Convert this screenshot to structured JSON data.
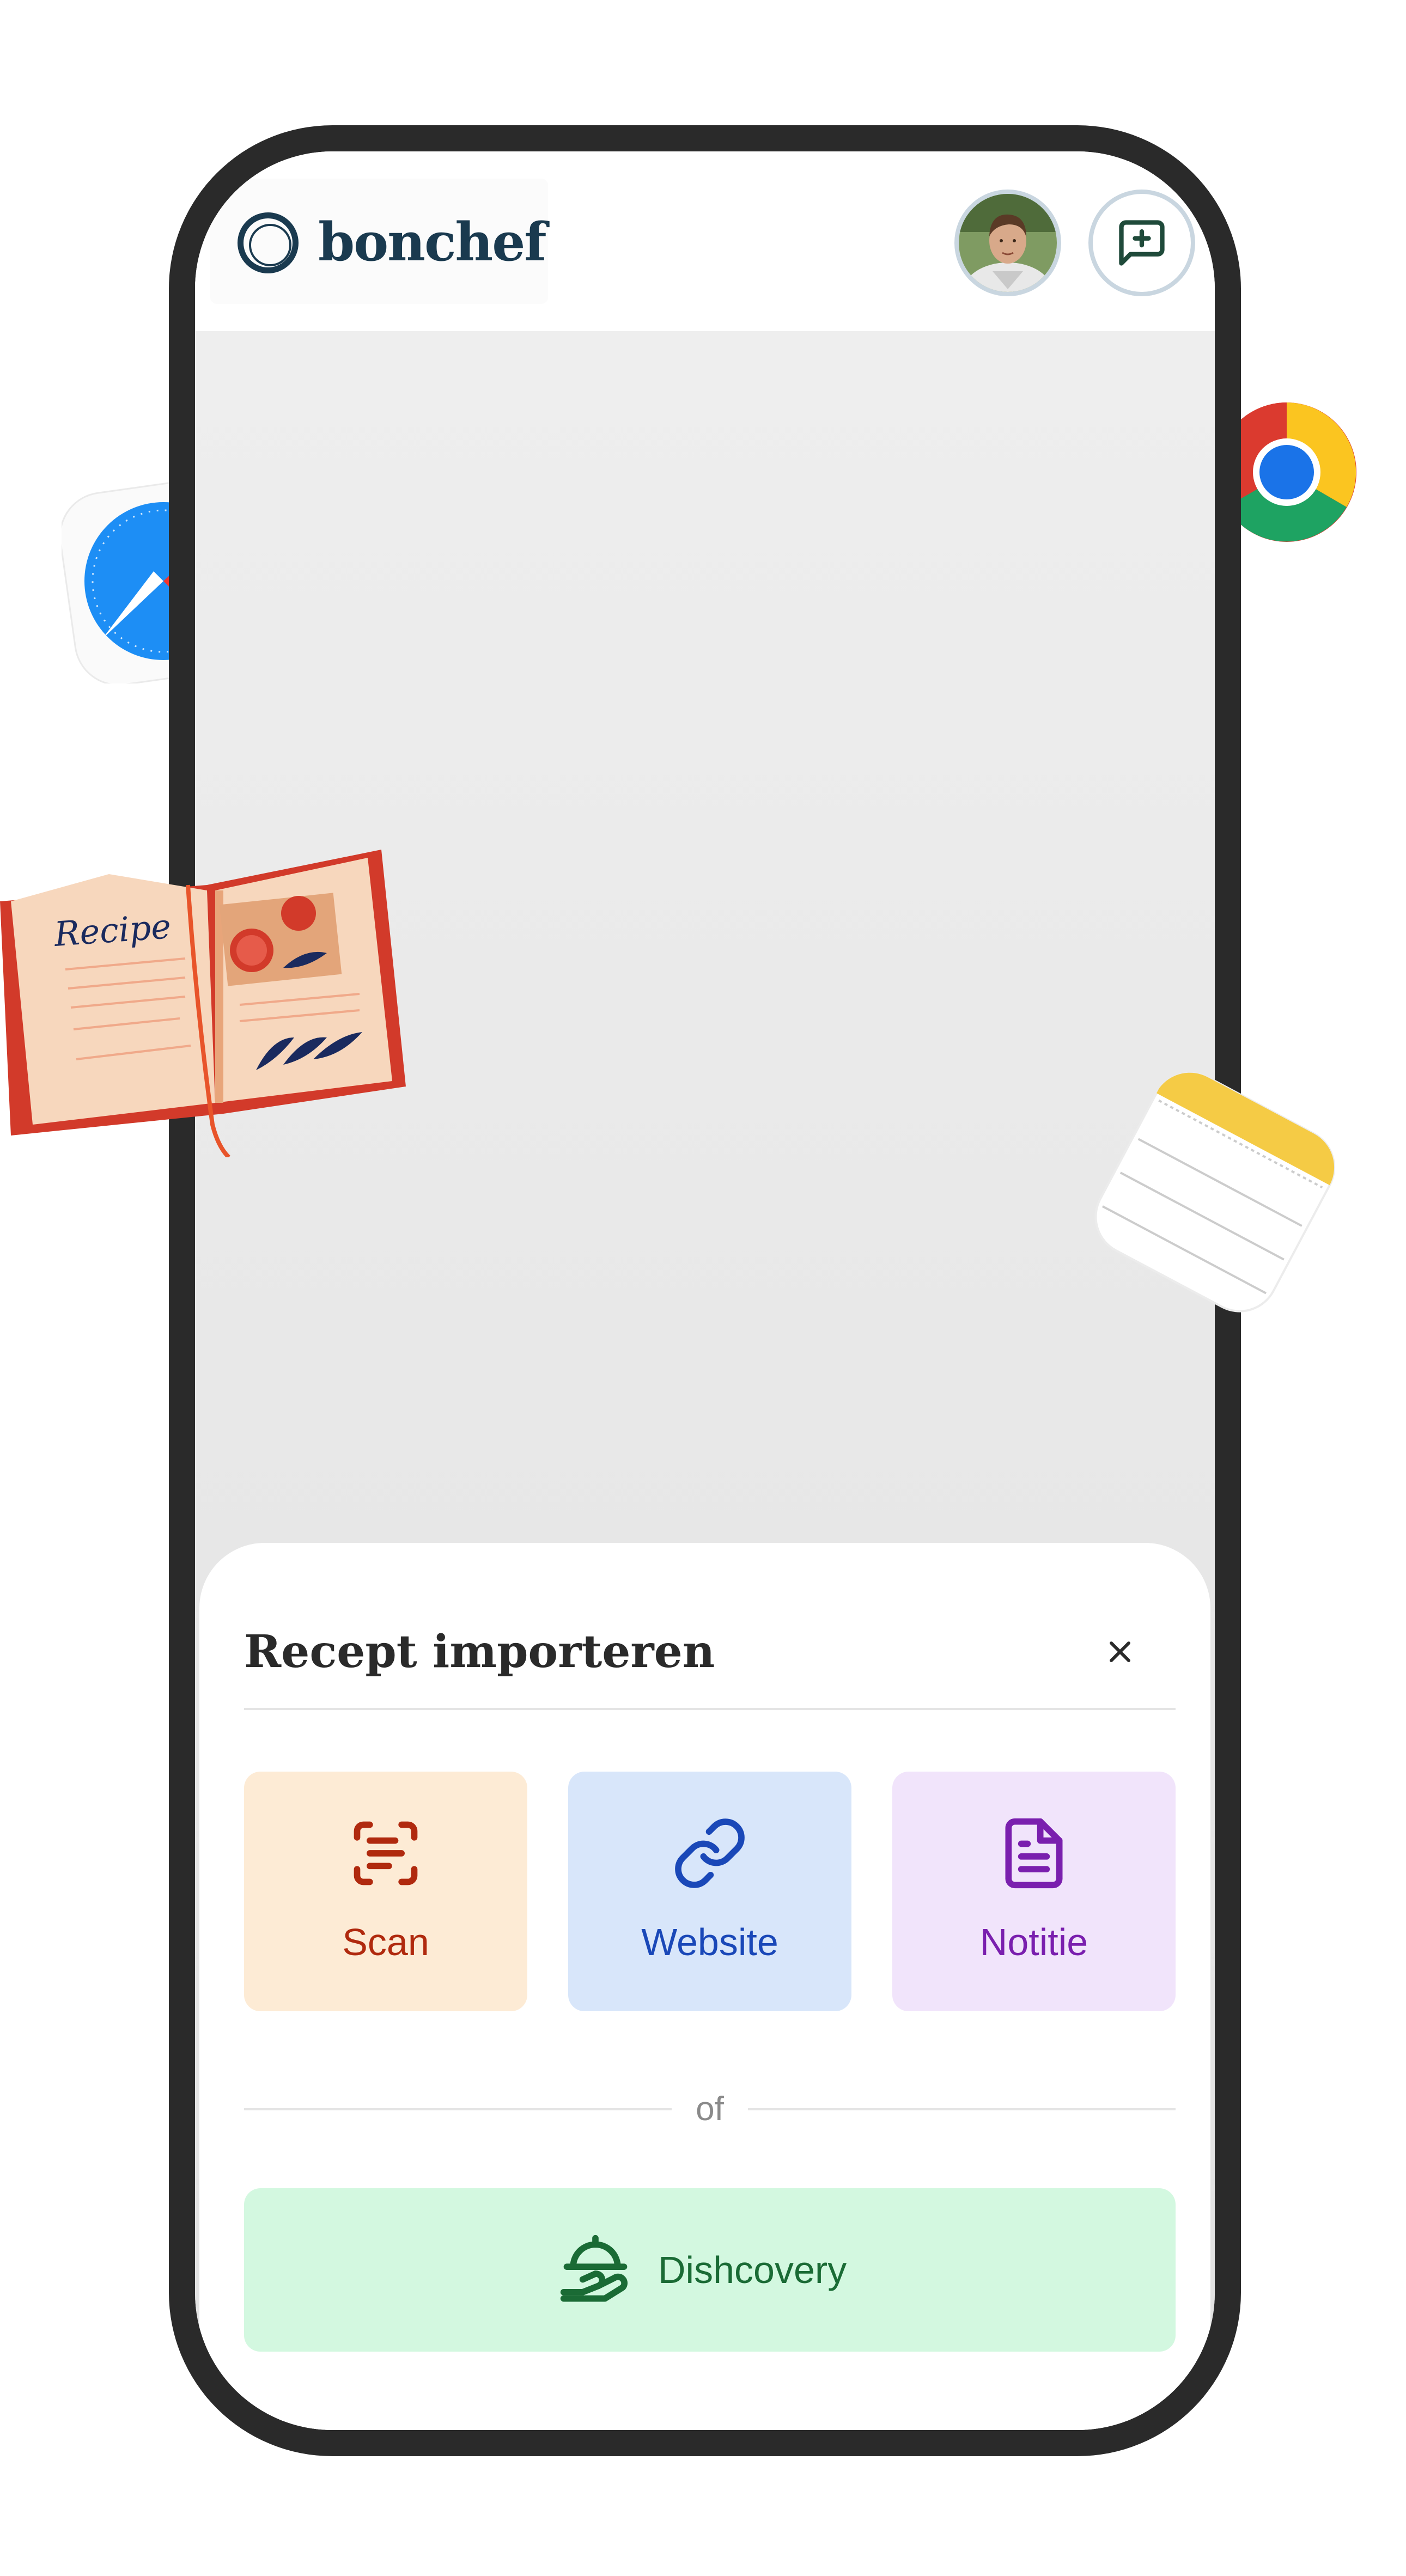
{
  "app": {
    "logo_text": "bonchef"
  },
  "header": {
    "avatar": "user-avatar",
    "new_chat_icon": "message-plus-icon"
  },
  "import_sheet": {
    "title": "Recept importeren",
    "close_icon": "close-icon",
    "options": [
      {
        "label": "Scan",
        "icon": "scan-text-icon",
        "color": "#b0290e",
        "background": "#fdebd5"
      },
      {
        "label": "Website",
        "icon": "link-icon",
        "color": "#1a48b8",
        "background": "#d8e6fa"
      },
      {
        "label": "Notitie",
        "icon": "file-text-icon",
        "color": "#7a1fae",
        "background": "#f1e4fb"
      }
    ],
    "separator_text": "of",
    "discovery": {
      "label": "Dishcovery",
      "icon": "cloche-serving-icon",
      "color": "#1a6b35",
      "background": "#d3f8e0"
    }
  },
  "decorations": {
    "safari": "safari-compass-icon",
    "chrome": "chrome-icon",
    "recipe_book_text": "Recipe",
    "notes": "notes-app-icon"
  }
}
